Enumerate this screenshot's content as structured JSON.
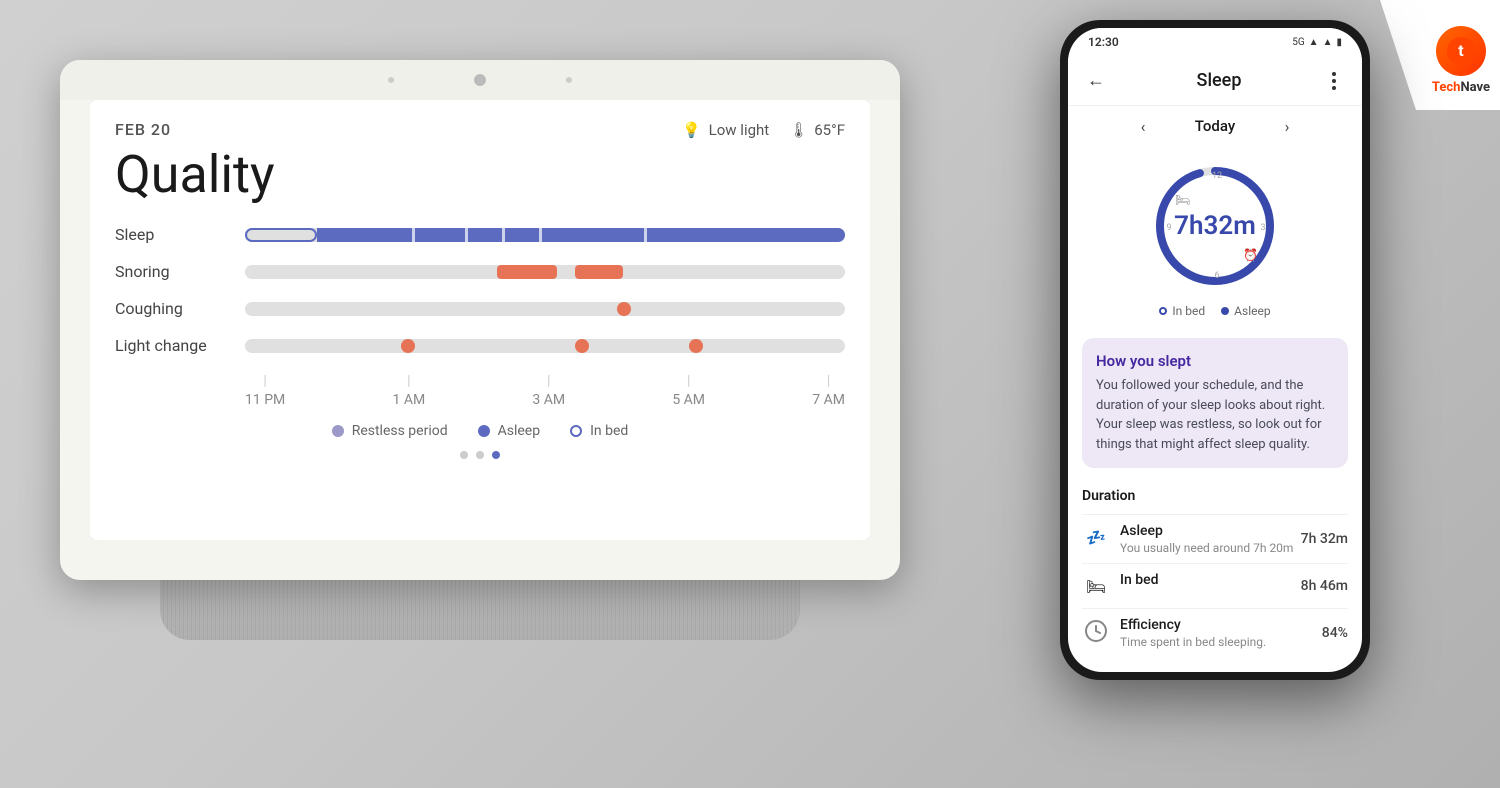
{
  "background": {
    "color": "#d0d0d0"
  },
  "technave": {
    "brand_text": "Tech",
    "brand_text2": "Nave",
    "icon_letter": "t"
  },
  "nest_hub": {
    "date": "FEB 20",
    "low_light_label": "Low light",
    "temp_label": "65°F",
    "quality_title": "Quality",
    "rows": [
      {
        "label": "Sleep"
      },
      {
        "label": "Snoring"
      },
      {
        "label": "Coughing"
      },
      {
        "label": "Light change"
      }
    ],
    "time_labels": [
      "11 PM",
      "1 AM",
      "3 AM",
      "5 AM",
      "7 AM"
    ],
    "legend": {
      "restless": "Restless period",
      "asleep": "Asleep",
      "inbed": "In bed"
    }
  },
  "phone": {
    "status_bar": {
      "time": "12:30",
      "network": "5G",
      "signal_icon": "▲",
      "wifi_icon": "▼",
      "battery_icon": "▮"
    },
    "app_bar": {
      "title": "Sleep",
      "back_label": "←",
      "more_label": "⋮"
    },
    "date_nav": {
      "label": "Today",
      "prev_icon": "‹",
      "next_icon": "›"
    },
    "sleep_circle": {
      "hours": "7",
      "unit_h": "h",
      "minutes": "32",
      "unit_m": "m"
    },
    "circle_legend": {
      "inbed_label": "In bed",
      "asleep_label": "Asleep"
    },
    "slept_card": {
      "title": "How you slept",
      "text": "You followed your schedule, and the duration of your sleep looks about right. Your sleep was restless, so look out for things that might affect sleep quality."
    },
    "duration_section": {
      "title": "Duration",
      "items": [
        {
          "icon": "💤",
          "name": "Asleep",
          "sub": "You usually need around 7h 20m",
          "value": "7h 32m"
        },
        {
          "icon": "🛏",
          "name": "In bed",
          "sub": "",
          "value": "8h 46m"
        },
        {
          "icon": "⏱",
          "name": "Efficiency",
          "sub": "Time spent in bed sleeping.",
          "value": "84%"
        }
      ]
    }
  }
}
